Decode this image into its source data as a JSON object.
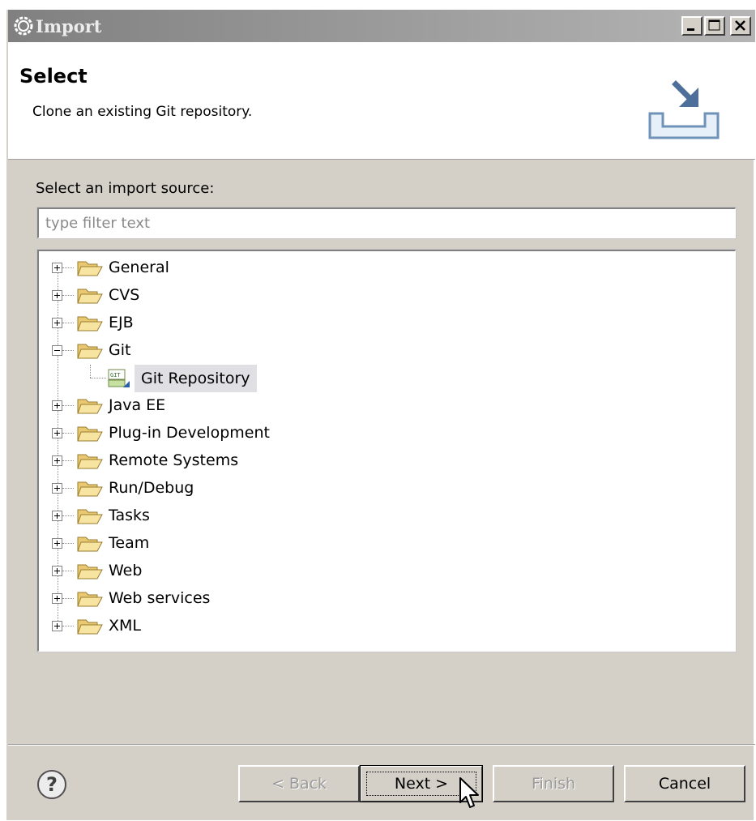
{
  "window": {
    "title": "Import",
    "controls": {
      "minimize": "minimize",
      "maximize": "maximize",
      "close": "close"
    }
  },
  "header": {
    "title": "Select",
    "description": "Clone an existing Git repository.",
    "icon": "import-wizard-icon"
  },
  "source": {
    "label": "Select an import source:",
    "filter_placeholder": "type filter text",
    "filter_value": ""
  },
  "tree": {
    "items": [
      {
        "label": "General",
        "expanded": false
      },
      {
        "label": "CVS",
        "expanded": false
      },
      {
        "label": "EJB",
        "expanded": false
      },
      {
        "label": "Git",
        "expanded": true,
        "children": [
          {
            "label": "Git Repository",
            "selected": true,
            "icon": "git-icon"
          }
        ]
      },
      {
        "label": "Java EE",
        "expanded": false
      },
      {
        "label": "Plug-in Development",
        "expanded": false
      },
      {
        "label": "Remote Systems",
        "expanded": false
      },
      {
        "label": "Run/Debug",
        "expanded": false
      },
      {
        "label": "Tasks",
        "expanded": false
      },
      {
        "label": "Team",
        "expanded": false
      },
      {
        "label": "Web",
        "expanded": false
      },
      {
        "label": "Web services",
        "expanded": false
      },
      {
        "label": "XML",
        "expanded": false
      }
    ]
  },
  "buttons": {
    "back": "< Back",
    "next": "Next >",
    "finish": "Finish",
    "cancel": "Cancel",
    "help": "?"
  },
  "colors": {
    "dialog_bg": "#d4d0c8",
    "title_bar": "#808080",
    "selection_bg": "#e0dfe3",
    "folder": "#f3dc8c"
  }
}
